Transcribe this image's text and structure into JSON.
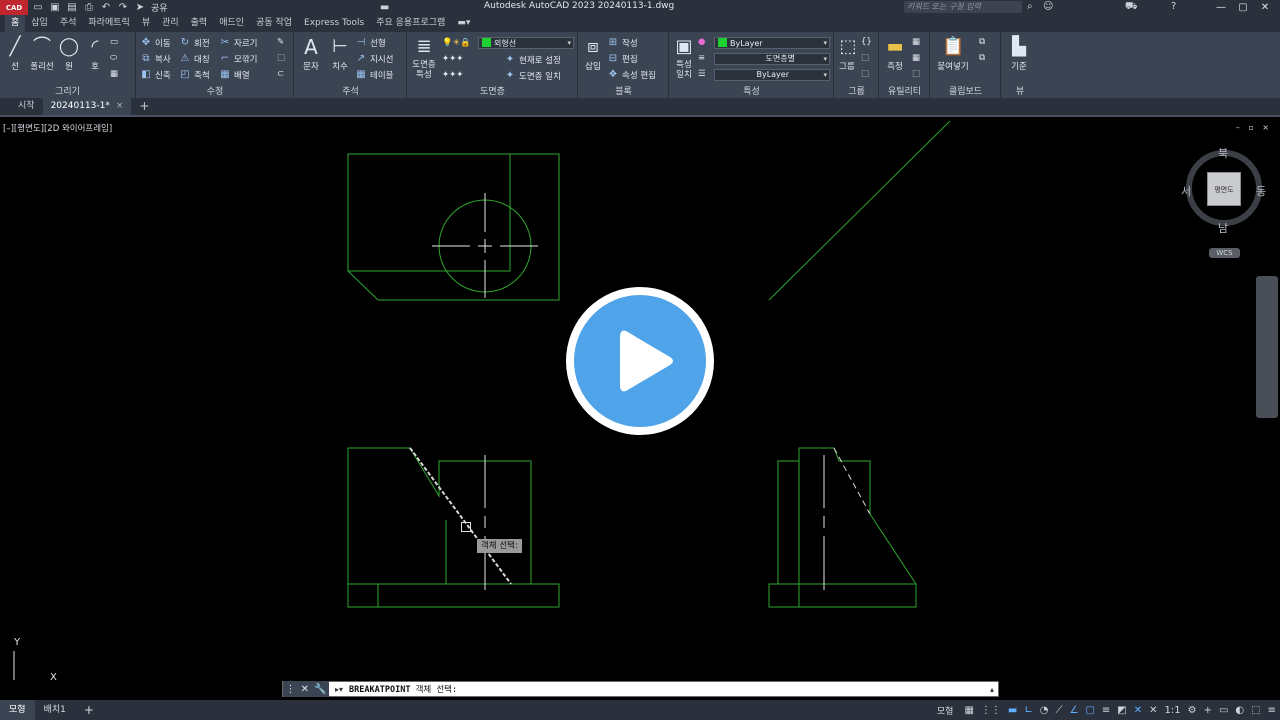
{
  "titlebar": {
    "app_logo": "CAD",
    "share_label": "공유",
    "window_title": "Autodesk AutoCAD 2023    20240113-1.dwg",
    "search_placeholder": "키워드 또는 구절 입력",
    "icons": [
      "open-icon",
      "save-icon",
      "saveas-icon",
      "plot-icon",
      "undo-icon",
      "redo-icon",
      "share-icon"
    ]
  },
  "ribbon_tabs": [
    "홈",
    "삽입",
    "주석",
    "파라메트릭",
    "뷰",
    "관리",
    "출력",
    "애드인",
    "공동 작업",
    "Express Tools",
    "주요 응용프로그램"
  ],
  "ribbon": {
    "draw": {
      "title": "그리기",
      "line": "선",
      "polyline": "폴리선",
      "circle": "원",
      "arc": "호"
    },
    "modify": {
      "title": "수정",
      "move": "이동",
      "rotate": "회전",
      "trim": "자르기",
      "copy": "복사",
      "mirror": "대칭",
      "fillet": "모깎기",
      "stretch": "신축",
      "scale": "축척",
      "array": "배열"
    },
    "annotation": {
      "title": "주석",
      "text": "문자",
      "dimension": "치수",
      "linear": "선형",
      "leader": "지시선",
      "table": "테이블"
    },
    "layers": {
      "title": "도면층",
      "properties": "도면층 특성",
      "current_layer": "외형선",
      "set_current": "현재로 설정",
      "match": "도면층 일치"
    },
    "block": {
      "title": "블록",
      "insert": "삽입",
      "create": "작성",
      "edit": "편집",
      "edit_attributes": "속성 편집"
    },
    "properties": {
      "title": "특성",
      "match": "특성 일치",
      "color": "ByLayer",
      "linetype": "도면층별",
      "lineweight": "ByLayer"
    },
    "groups": {
      "title": "그룹",
      "group": "그룹"
    },
    "utilities": {
      "title": "유틸리티",
      "measure": "측정"
    },
    "clipboard": {
      "title": "클립보드",
      "paste": "붙여넣기"
    },
    "view": {
      "title": "뷰",
      "base": "기준"
    }
  },
  "file_tabs": {
    "start": "시작",
    "active": "20240113-1*",
    "close": "×",
    "add": "+"
  },
  "viewport": {
    "label": "[–][평면도][2D 와이어프레임]",
    "controls": "– ▫ ×"
  },
  "viewcube": {
    "face": "평면도",
    "north": "북",
    "south": "남",
    "west": "서",
    "east": "동",
    "wcs": "WCS"
  },
  "cursor_tooltip": "객체 선택:",
  "ucs": {
    "y": "Y",
    "x": "X"
  },
  "command_line": {
    "command": "BREAKATPOINT",
    "prompt": "객체 선택:"
  },
  "status_bar": {
    "tabs": [
      "모형",
      "배치1"
    ],
    "add": "+",
    "model_label": "모형",
    "zoom": "1:1"
  },
  "colors": {
    "drawing_line": "#2fa62f",
    "accent": "#4ea3e9",
    "layer_swatch": "#1fd130"
  }
}
